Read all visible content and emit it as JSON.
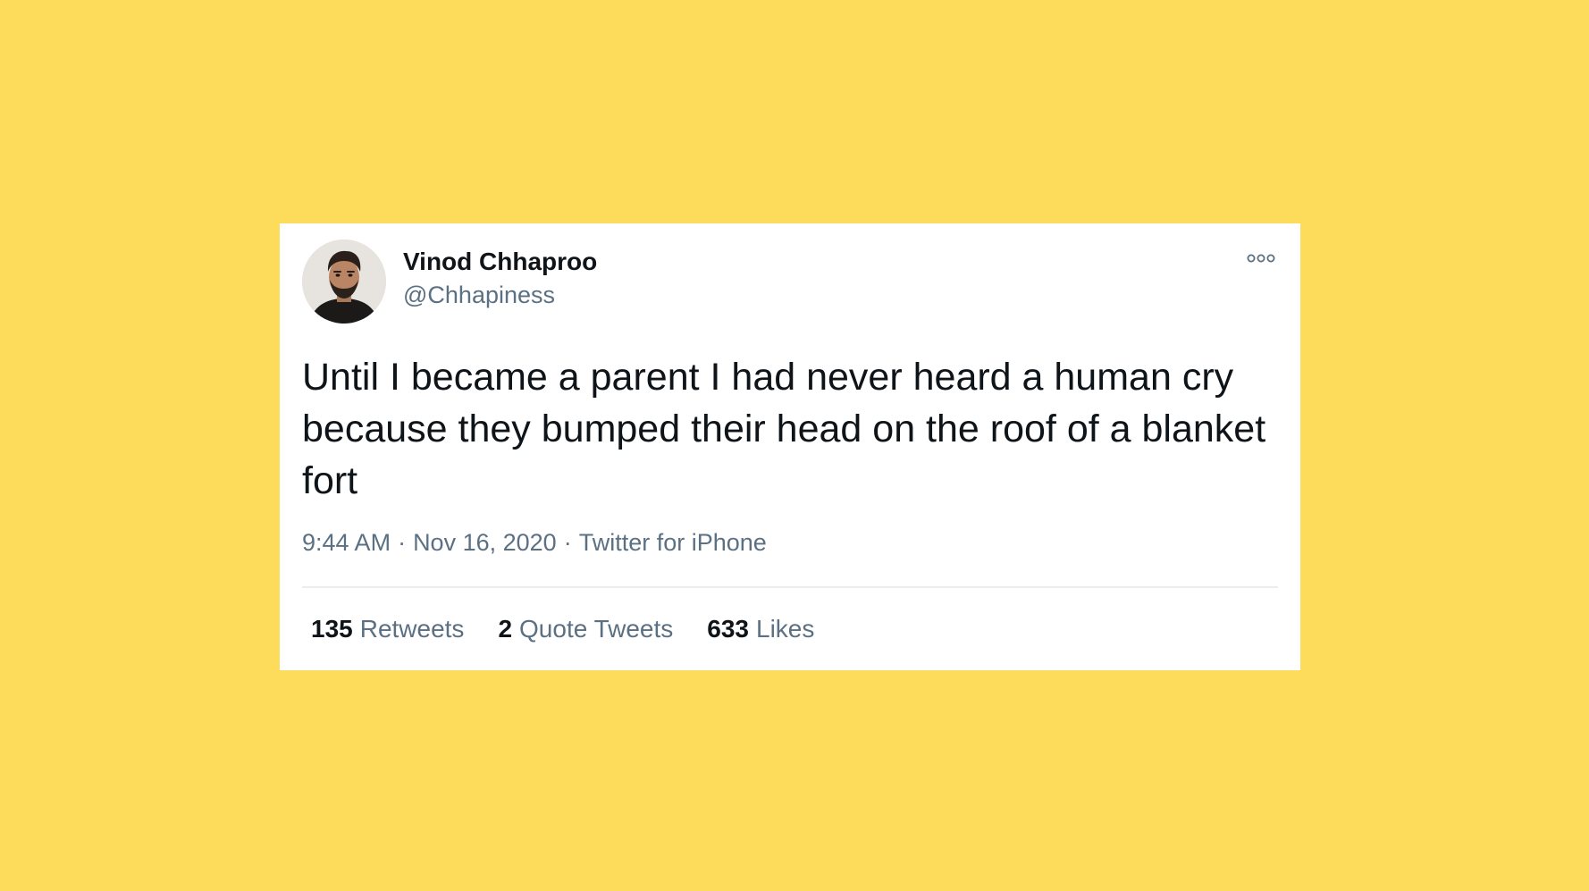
{
  "tweet": {
    "author_name": "Vinod Chhaproo",
    "handle": "@Chhapiness",
    "text": "Until I became a parent I had never heard a human cry because they bumped their head on the roof of a blanket fort",
    "time": "9:44 AM",
    "date": "Nov 16, 2020",
    "source": "Twitter for iPhone",
    "separator": "·",
    "stats": {
      "retweets_count": "135",
      "retweets_label": "Retweets",
      "quotes_count": "2",
      "quotes_label": "Quote Tweets",
      "likes_count": "633",
      "likes_label": "Likes"
    }
  },
  "icons": {
    "more": "more-horizontal-icon",
    "avatar": "profile-photo"
  },
  "colors": {
    "background": "#FEDC5B",
    "card": "#FFFFFF",
    "primary_text": "#0F1419",
    "secondary_text": "#5B7083",
    "divider": "#EBEEF0"
  }
}
